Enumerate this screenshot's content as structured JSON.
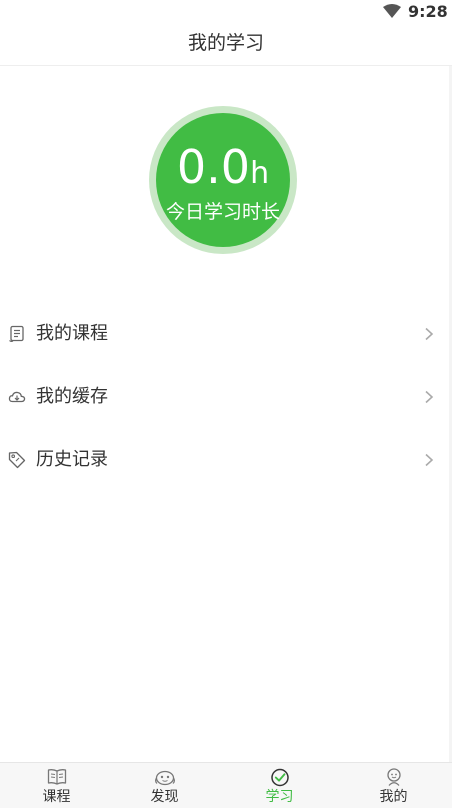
{
  "status_bar": {
    "time": "9:28",
    "wifi_icon": "wifi-icon"
  },
  "header": {
    "title": "我的学习"
  },
  "study_summary": {
    "hours_value": "0.0",
    "hours_unit": "h",
    "caption": "今日学习时长",
    "ring_color": "#c9e7c6",
    "fill_color": "#41bc44"
  },
  "menu": {
    "items": [
      {
        "label": "我的课程",
        "icon": "course-list-icon"
      },
      {
        "label": "我的缓存",
        "icon": "cloud-cache-icon"
      },
      {
        "label": "历史记录",
        "icon": "tag-history-icon"
      }
    ]
  },
  "tab_bar": {
    "active_color": "#41bc44",
    "items": [
      {
        "label": "课程",
        "icon": "book-icon"
      },
      {
        "label": "发现",
        "icon": "discover-icon"
      },
      {
        "label": "学习",
        "icon": "check-circle-icon",
        "active": true
      },
      {
        "label": "我的",
        "icon": "profile-icon"
      }
    ]
  }
}
